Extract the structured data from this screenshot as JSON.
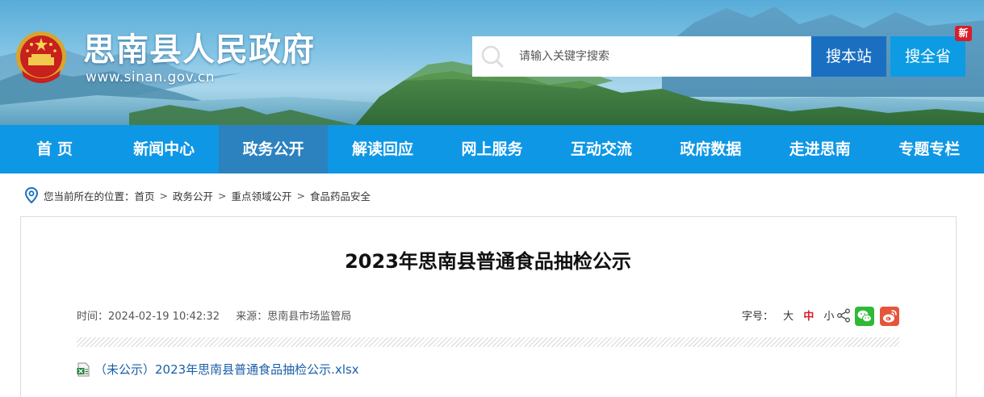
{
  "header": {
    "site_title": "思南县人民政府",
    "site_url": "www.sinan.gov.cn",
    "search_placeholder": "请输入关键字搜索",
    "search_site_label": "搜本站",
    "search_all_label": "搜全省",
    "new_badge": "新"
  },
  "nav": {
    "items": [
      "首 页",
      "新闻中心",
      "政务公开",
      "解读回应",
      "网上服务",
      "互动交流",
      "政府数据",
      "走进思南",
      "专题专栏"
    ],
    "active": "政务公开"
  },
  "breadcrumb": {
    "prefix": "您当前所在的位置：",
    "items": [
      "首页",
      "政务公开",
      "重点领域公开",
      "食品药品安全"
    ],
    "separator": ">"
  },
  "article": {
    "title": "2023年思南县普通食品抽检公示",
    "time": "时间：2024-02-19 10:42:32",
    "source": "来源：思南县市场监管局",
    "fontsize_label": "字号：",
    "fontsize_options": [
      "大",
      "中",
      "小"
    ],
    "fontsize_active": "中",
    "attachment": "（未公示）2023年思南县普通食品抽检公示.xlsx"
  },
  "colors": {
    "nav_bg": "#0e97e5",
    "nav_active": "#2b82bf",
    "search_site_btn": "#1a6fc1",
    "search_all_btn": "#0d9ce3",
    "badge": "#d81e28",
    "link": "#1a5fa8"
  },
  "icons": [
    "national-emblem-icon",
    "search-icon",
    "location-pin-icon",
    "share-icon",
    "wechat-icon",
    "weibo-icon",
    "xlsx-file-icon"
  ]
}
